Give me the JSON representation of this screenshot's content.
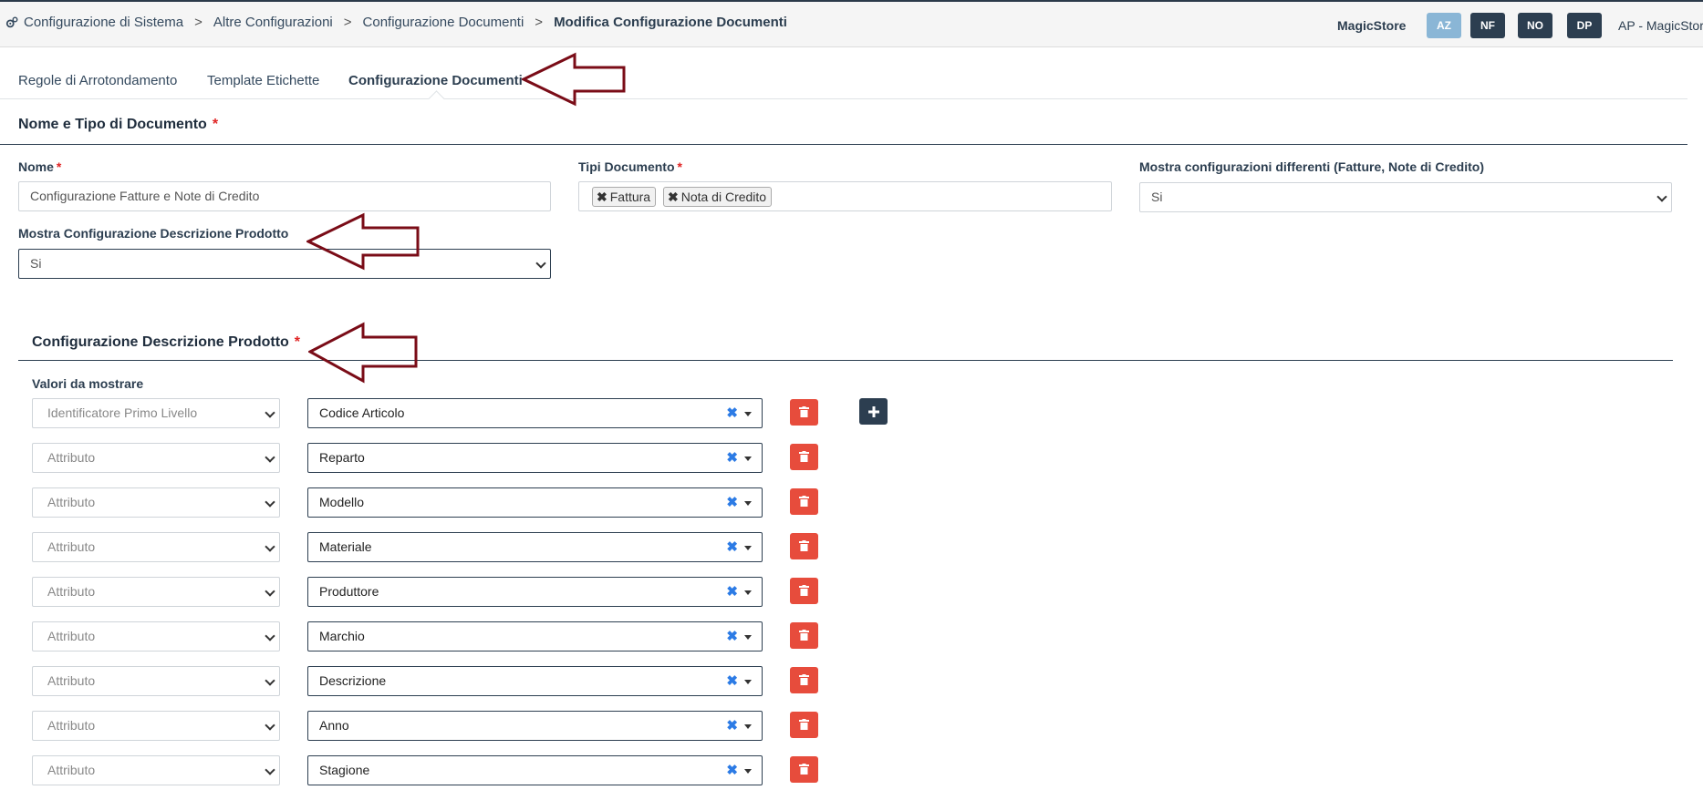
{
  "breadcrumb": {
    "items": [
      "Configurazione di Sistema",
      "Altre Configurazioni",
      "Configurazione Documenti"
    ],
    "current": "Modifica Configurazione Documenti",
    "separator": ">"
  },
  "header": {
    "store": "MagicStore",
    "buttons": [
      {
        "label": "AZ",
        "color": "#8ab6d6"
      },
      {
        "label": "NF",
        "color": "#2c3e50"
      },
      {
        "label": "NO",
        "color": "#2c3e50"
      },
      {
        "label": "DP",
        "color": "#2c3e50"
      }
    ],
    "user": "AP - MagicStore"
  },
  "tabs": [
    "Regole di Arrotondamento",
    "Template Etichette",
    "Configurazione Documenti"
  ],
  "section1": {
    "title": "Nome e Tipo di Documento",
    "required": "*",
    "nome_label": "Nome",
    "nome_value": "Configurazione Fatture e Note di Credito",
    "tipi_label": "Tipi Documento",
    "tipi_tags": [
      "Fattura",
      "Nota di Credito"
    ],
    "mostra_diff_label": "Mostra configurazioni differenti (Fatture, Note di Credito)",
    "mostra_diff_value": "Si",
    "mostra_desc_label": "Mostra Configurazione Descrizione Prodotto",
    "mostra_desc_value": "Si"
  },
  "section2": {
    "title": "Configurazione Descrizione Prodotto",
    "required": "*",
    "values_label": "Valori da mostrare",
    "rows": [
      {
        "type": "Identificatore Primo Livello",
        "value": "Codice Articolo"
      },
      {
        "type": "Attributo",
        "value": "Reparto"
      },
      {
        "type": "Attributo",
        "value": "Modello"
      },
      {
        "type": "Attributo",
        "value": "Materiale"
      },
      {
        "type": "Attributo",
        "value": "Produttore"
      },
      {
        "type": "Attributo",
        "value": "Marchio"
      },
      {
        "type": "Attributo",
        "value": "Descrizione"
      },
      {
        "type": "Attributo",
        "value": "Anno"
      },
      {
        "type": "Attributo",
        "value": "Stagione"
      }
    ]
  },
  "icons": {
    "gear": "gears-icon",
    "trash": "trash-icon",
    "plus": "plus-icon",
    "clear": "clear-x-icon",
    "annotation": "red-arrow-annotation"
  },
  "colors": {
    "danger": "#e74c3c",
    "primary_dark": "#2c3e50",
    "annotation": "#7a0c17",
    "required": "#e02424"
  }
}
